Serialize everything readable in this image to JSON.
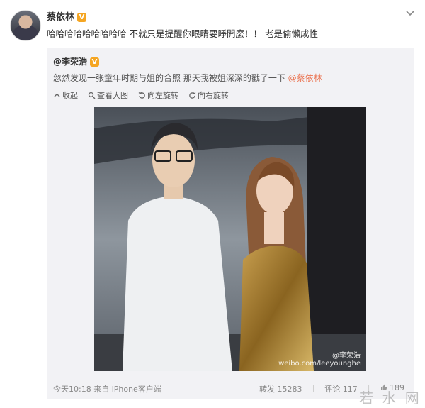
{
  "post": {
    "username": "蔡依林",
    "badge": "V",
    "text": "哈哈哈哈哈哈哈哈哈 不就只是提醒你眼睛要睜開麼！！ 老是偷懶成性"
  },
  "repost": {
    "username": "@李荣浩",
    "badge": "V",
    "text": "忽然发现一张童年时期与姐的合照 那天我被姐深深的戳了一下 ",
    "mention": "@蔡依林",
    "toolbar": [
      {
        "icon": "collapse-arrow-icon",
        "label": "收起"
      },
      {
        "icon": "magnify-icon",
        "label": "查看大图"
      },
      {
        "icon": "rotate-left-icon",
        "label": "向左旋转"
      },
      {
        "icon": "rotate-right-icon",
        "label": "向右旋转"
      }
    ],
    "watermark": {
      "line1": "@李荣浩",
      "line2": "weibo.com/leeyounghe"
    },
    "footer": {
      "time_source": "今天10:18 来自 iPhone客户端",
      "repost": "转发 15283",
      "comment": "评论 117",
      "like": "189"
    }
  },
  "site_watermark": "若 水 网",
  "colors": {
    "accent": "#eb7350",
    "badge": "#f5a623",
    "repost_bg": "#f2f2f5"
  }
}
